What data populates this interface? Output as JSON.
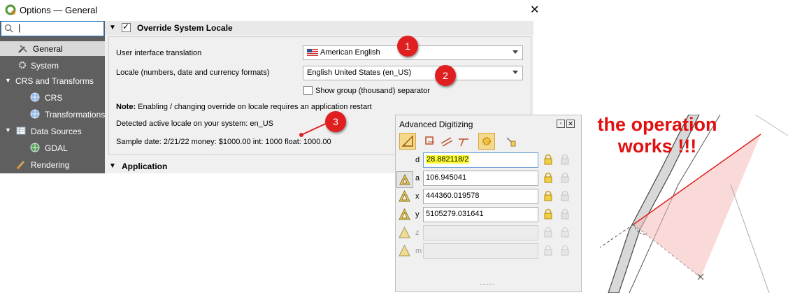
{
  "window": {
    "title": "Options — General",
    "search_value": "|"
  },
  "sidebar": {
    "items": [
      {
        "label": "General"
      },
      {
        "label": "System"
      },
      {
        "label": "CRS and Transforms"
      },
      {
        "label": "CRS"
      },
      {
        "label": "Transformations"
      },
      {
        "label": "Data Sources"
      },
      {
        "label": "GDAL"
      },
      {
        "label": "Rendering"
      }
    ]
  },
  "override_section": {
    "title": "Override System Locale",
    "checked": true,
    "translation_label": "User interface translation",
    "translation_value": "American English",
    "locale_label": "Locale (numbers, date and currency formats)",
    "locale_value": "English United States (en_US)",
    "group_sep_label": "Show group (thousand) separator",
    "note_bold": "Note:",
    "note_text": "Enabling / changing override on locale requires an application restart",
    "detected": "Detected active locale on your system: en_US",
    "sample": "Sample date: 2/21/22 money: $1000.00 int: 1000 float: 1000.00"
  },
  "application_section": {
    "title": "Application"
  },
  "badges": [
    "1",
    "2",
    "3"
  ],
  "adv_digitizing": {
    "title": "Advanced Digitizing",
    "fields": [
      {
        "label": "d",
        "value": "28.882118/2"
      },
      {
        "label": "a",
        "value": "106.945041"
      },
      {
        "label": "x",
        "value": "444360.019578"
      },
      {
        "label": "y",
        "value": "5105279.031641"
      },
      {
        "label": "z",
        "value": ""
      },
      {
        "label": "m",
        "value": ""
      }
    ]
  },
  "annotation": {
    "line1": "the operation",
    "line2": "works !!!"
  },
  "colors": {
    "accent_red": "#e02020",
    "highlight_yellow": "#ffff33",
    "sidebar_bg": "#5f5f5f"
  }
}
